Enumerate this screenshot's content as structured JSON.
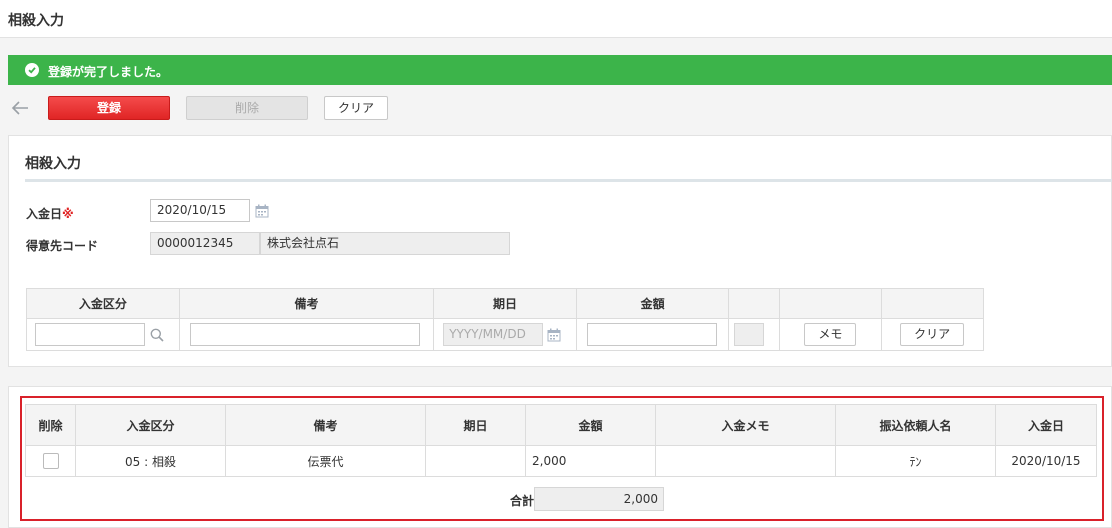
{
  "page": {
    "title": "相殺入力"
  },
  "alert": {
    "message": "登録が完了しました。",
    "color": "#3cb44a"
  },
  "toolbar": {
    "save_label": "登録",
    "delete_label": "削除",
    "clear_label": "クリア"
  },
  "form": {
    "section_title": "相殺入力",
    "deposit_date": {
      "label": "入金日",
      "required_mark": "※",
      "value": "2020/10/15"
    },
    "customer": {
      "label": "得意先コード",
      "code": "0000012345",
      "name": "株式会社点石"
    }
  },
  "entry_table": {
    "headers": [
      "入金区分",
      "備考",
      "期日",
      "金額",
      "",
      "",
      ""
    ],
    "row": {
      "deposit_type": "",
      "remarks": "",
      "due_date_placeholder": "YYYY/MM/DD",
      "amount": "",
      "memo_button": "メモ",
      "clear_button": "クリア"
    }
  },
  "list_table": {
    "headers": [
      "削除",
      "入金区分",
      "備考",
      "期日",
      "金額",
      "入金メモ",
      "振込依頼人名",
      "入金日"
    ],
    "rows": [
      {
        "delete": false,
        "deposit_type": "05 : 相殺",
        "remarks": "伝票代",
        "due_date": "",
        "amount": "2,000",
        "memo": "",
        "payer_name": "ﾃﾝ",
        "deposit_date": "2020/10/15"
      }
    ],
    "total_label": "合計",
    "total_value": "2,000"
  },
  "colors": {
    "accent_red": "#e02525",
    "success_green": "#3cb44a",
    "highlight_frame": "#d9212a"
  },
  "icons": [
    "check-circle-icon",
    "back-arrow-icon",
    "calendar-icon",
    "search-icon"
  ]
}
